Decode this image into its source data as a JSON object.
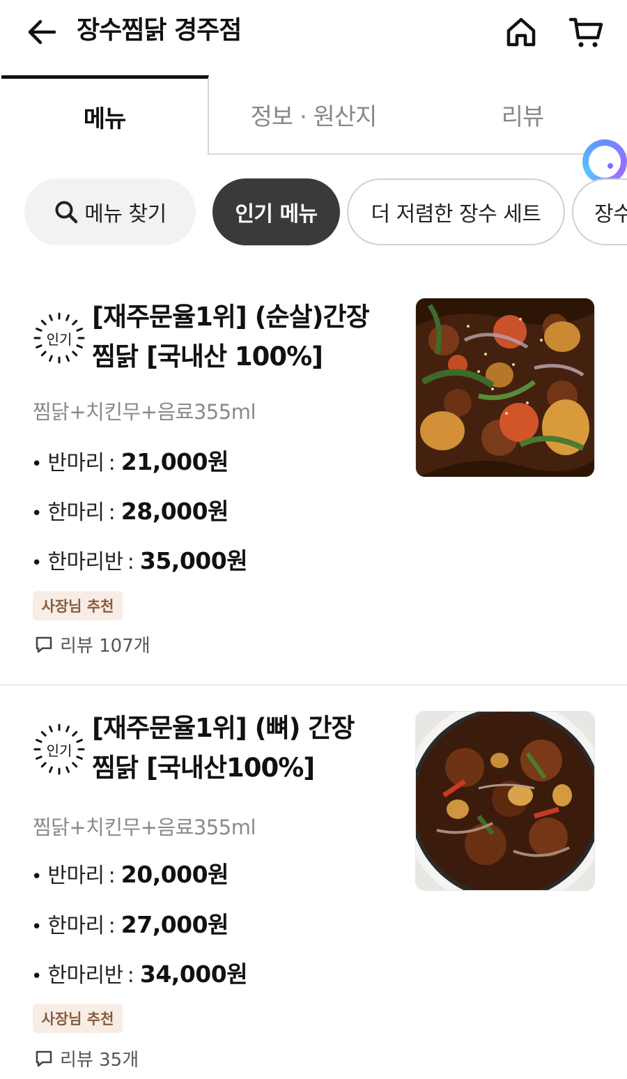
{
  "header": {
    "title": "장수찜닭 경주점",
    "icons": {
      "back": "back-arrow-icon",
      "home": "home-icon",
      "cart": "cart-icon"
    }
  },
  "tabs": [
    {
      "label": "메뉴",
      "active": true
    },
    {
      "label": "정보 · 원산지",
      "active": false
    },
    {
      "label": "리뷰",
      "active": false
    }
  ],
  "chips": {
    "search_label": "메뉴 찾기",
    "items": [
      {
        "label": "인기 메뉴",
        "active": true
      },
      {
        "label": "더 저렴한 장수 세트",
        "active": false
      },
      {
        "label": "장수",
        "active": false
      }
    ]
  },
  "menu": [
    {
      "badge": "인기",
      "name_line1": "[재주문율1위] (순살)간장",
      "name_line2": "찜닭 [국내산 100%]",
      "description": "찜닭+치킨무+음료355ml",
      "prices": [
        {
          "label": "반마리",
          "value": "21,000원"
        },
        {
          "label": "한마리",
          "value": "28,000원"
        },
        {
          "label": "한마리반",
          "value": "35,000원"
        }
      ],
      "tag": "사장님 추천",
      "review": "리뷰 107개"
    },
    {
      "badge": "인기",
      "name_line1": "[재주문율1위] (뼈) 간장",
      "name_line2": "찜닭 [국내산100%]",
      "description": "찜닭+치킨무+음료355ml",
      "prices": [
        {
          "label": "반마리",
          "value": "20,000원"
        },
        {
          "label": "한마리",
          "value": "27,000원"
        },
        {
          "label": "한마리반",
          "value": "34,000원"
        }
      ],
      "tag": "사장님 추천",
      "review": "리뷰 35개"
    }
  ],
  "colors": {
    "active_chip": "#3a3a3a",
    "tag_bg": "#f7ede6",
    "tag_text": "#8b5a3c",
    "muted_text": "#8a8a8a"
  }
}
